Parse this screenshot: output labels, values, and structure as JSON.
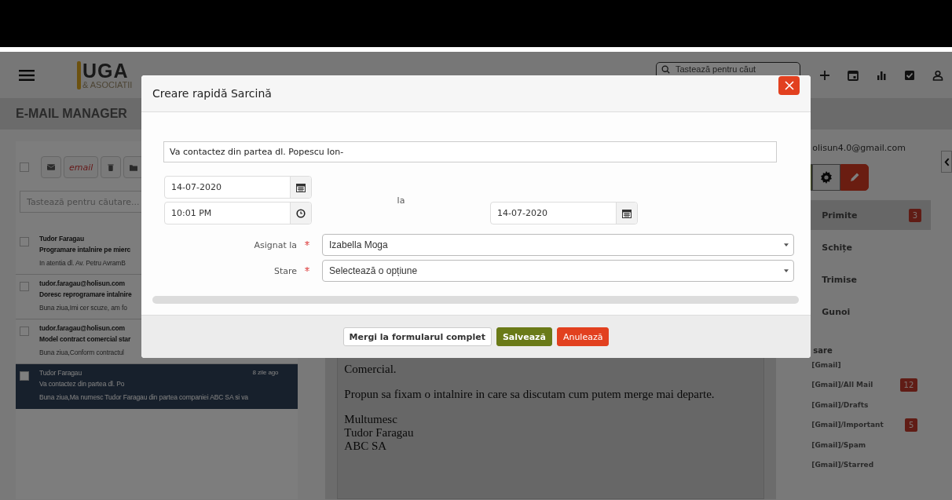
{
  "app_header": {
    "logo": {
      "mark": "UGA",
      "tagline": "& ASOCIATII"
    },
    "search": {
      "placeholder": "Tastează pentru căut"
    }
  },
  "section_title": "E-MAIL MANAGER",
  "mail_list": {
    "select_all_checked": false,
    "toolbar_label": "email",
    "search": {
      "placeholder": "Tastează pentru căutare..."
    },
    "messages": [
      {
        "sender": "Tudor Faragau",
        "subject": "Programare intalnire pe mierc",
        "preview": "In atentia dl. Av. Petru AvramB",
        "checked": false,
        "selected": false
      },
      {
        "sender": "tudor.faragau@holisun.com",
        "subject": "Doresc reprogramare intalnire",
        "preview": "Buna ziua,Imi cer scuze, am fo",
        "checked": false,
        "selected": false
      },
      {
        "sender": "tudor.faragau@holisun.com",
        "subject": "Model contract comercial star",
        "preview": "Buna ziua,Conform contractul",
        "checked": false,
        "selected": false
      },
      {
        "sender": "Tudor Faragau",
        "subject": "Va contactez din partea dl. Po",
        "preview": "Buna ziua,Ma numesc Tudor Faragau din partea companiei ABC SA si va",
        "time": "8 zile ago",
        "checked": false,
        "selected": true
      }
    ]
  },
  "message_body": {
    "paragraphs": [
      [
        "Comercial."
      ],
      [
        "Propun sa fixam o intalnire in care sa discutam cum putem merge mai departe."
      ],
      [
        "Multumesc",
        "Tudor Faragau",
        "ABC SA"
      ]
    ]
  },
  "account": {
    "email": "olisun4.0@gmail.com"
  },
  "folders": [
    {
      "name": "Primite",
      "count": "3",
      "selected": true
    },
    {
      "name": "Schițe",
      "selected": false
    },
    {
      "name": "Trimise",
      "selected": false
    },
    {
      "name": "Gunoi",
      "selected": false
    }
  ],
  "labels_heading": "sare",
  "labels": [
    {
      "name": "[Gmail]"
    },
    {
      "name": "[Gmail]/All Mail",
      "count": "12"
    },
    {
      "name": "[Gmail]/Drafts"
    },
    {
      "name": "[Gmail]/Important",
      "count": "5"
    },
    {
      "name": "[Gmail]/Spam"
    },
    {
      "name": "[Gmail]/Starred"
    }
  ],
  "dialog": {
    "title": "Creare rapidă Sarcină",
    "subject": "Va contactez din partea dl. Popescu Ion-",
    "start_date": "14-07-2020",
    "start_time": "10:01 PM",
    "separator": "la",
    "end_date": "14-07-2020",
    "fields": [
      {
        "label": "Asignat la",
        "required": true,
        "value": "Izabella Moga"
      },
      {
        "label": "Stare",
        "required": true,
        "placeholder": "Selectează o opțiune"
      }
    ],
    "buttons": [
      {
        "label": "Mergi la formularul complet",
        "kind": "default"
      },
      {
        "label": "Salvează",
        "kind": "primary"
      },
      {
        "label": "Anulează",
        "kind": "danger"
      }
    ]
  }
}
